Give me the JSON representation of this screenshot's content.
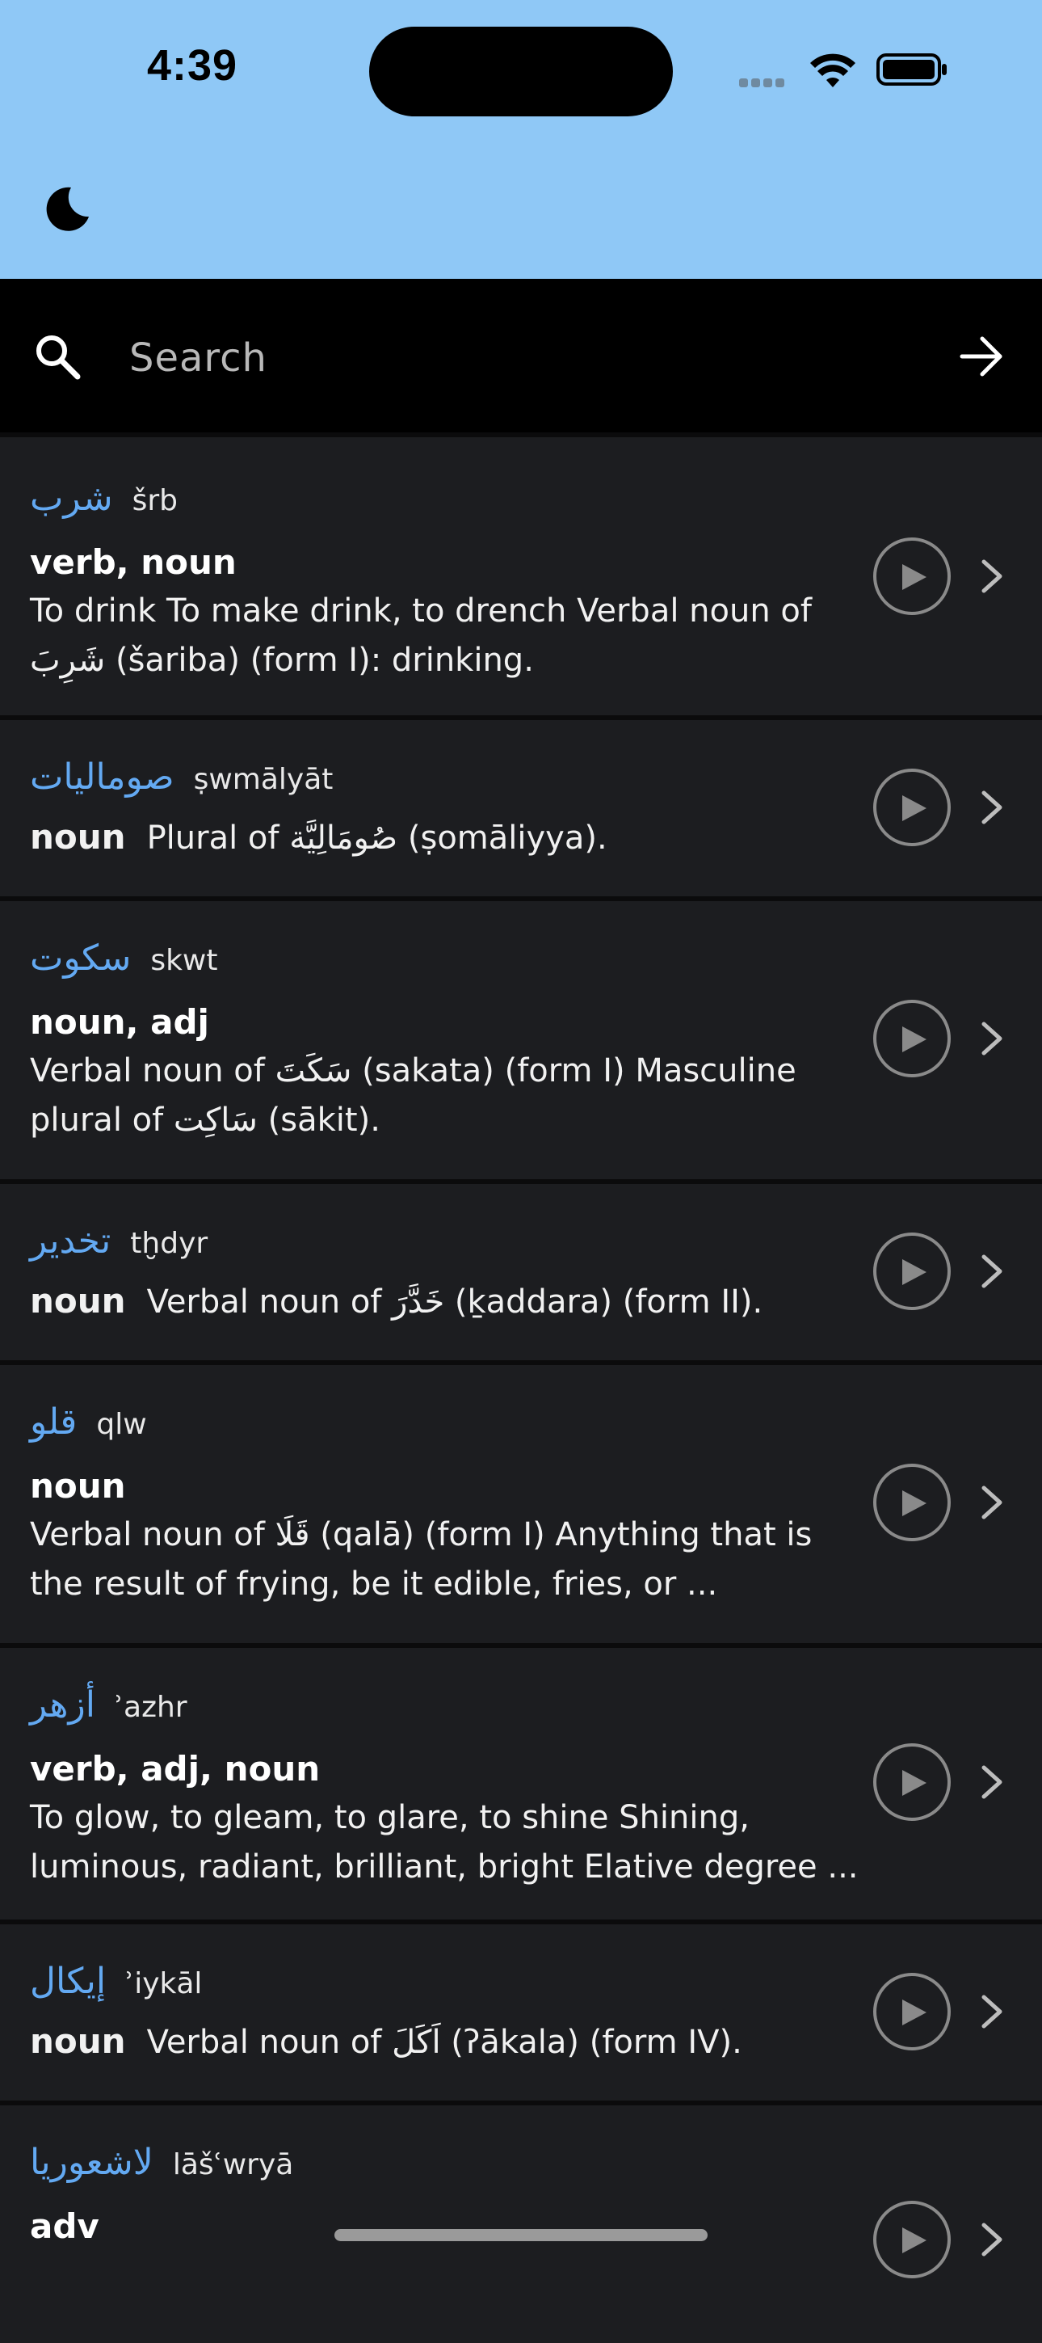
{
  "status_bar": {
    "time": "4:39",
    "background": "#8fc8f6"
  },
  "toolbar": {
    "theme_icon": "moon-icon"
  },
  "search": {
    "placeholder": "Search",
    "value": "",
    "icon": "search-icon",
    "submit_icon": "arrow-right-icon"
  },
  "entries": [
    {
      "arabic": "شرب",
      "translit": "šrb",
      "pos": "verb, noun",
      "definition": "To drink To make drink, to drench Verbal noun of شَرِبَ (šariba) (form I): drinking."
    },
    {
      "arabic": "صوماليات",
      "translit": "ṣwmālyāt",
      "pos": "noun",
      "definition": "Plural of صُومَالِيَّة (ṣomāliyya)."
    },
    {
      "arabic": "سكوت",
      "translit": "skwt",
      "pos": "noun, adj",
      "definition": "Verbal noun of سَكَتَ (sakata) (form I) Masculine plural of سَاكِت (sākit)."
    },
    {
      "arabic": "تخدير",
      "translit": "tḫdyr",
      "pos": "noun",
      "definition": "Verbal noun of خَدَّرَ (ḵaddara) (form II)."
    },
    {
      "arabic": "قلو",
      "translit": "qlw",
      "pos": "noun",
      "definition": "Verbal noun of قَلَا (qalā) (form I) Anything that is the result of frying, be it edible, fries, or ..."
    },
    {
      "arabic": "أزهر",
      "translit": "ʾazhr",
      "pos": "verb, adj, noun",
      "definition": "To glow, to gleam, to glare, to shine Shining, luminous, radiant, brilliant, bright Elative degree ..."
    },
    {
      "arabic": "إيكال",
      "translit": "ʾiykāl",
      "pos": "noun",
      "definition": "Verbal noun of اَكَلَ (ʔākala) (form IV)."
    },
    {
      "arabic": "لاشعوريا",
      "translit": "lāšʿwryā",
      "pos": "adv",
      "definition": ""
    }
  ],
  "colors": {
    "accent": "#63a9f2",
    "background": "#1c1d20",
    "search_background": "#000000"
  }
}
